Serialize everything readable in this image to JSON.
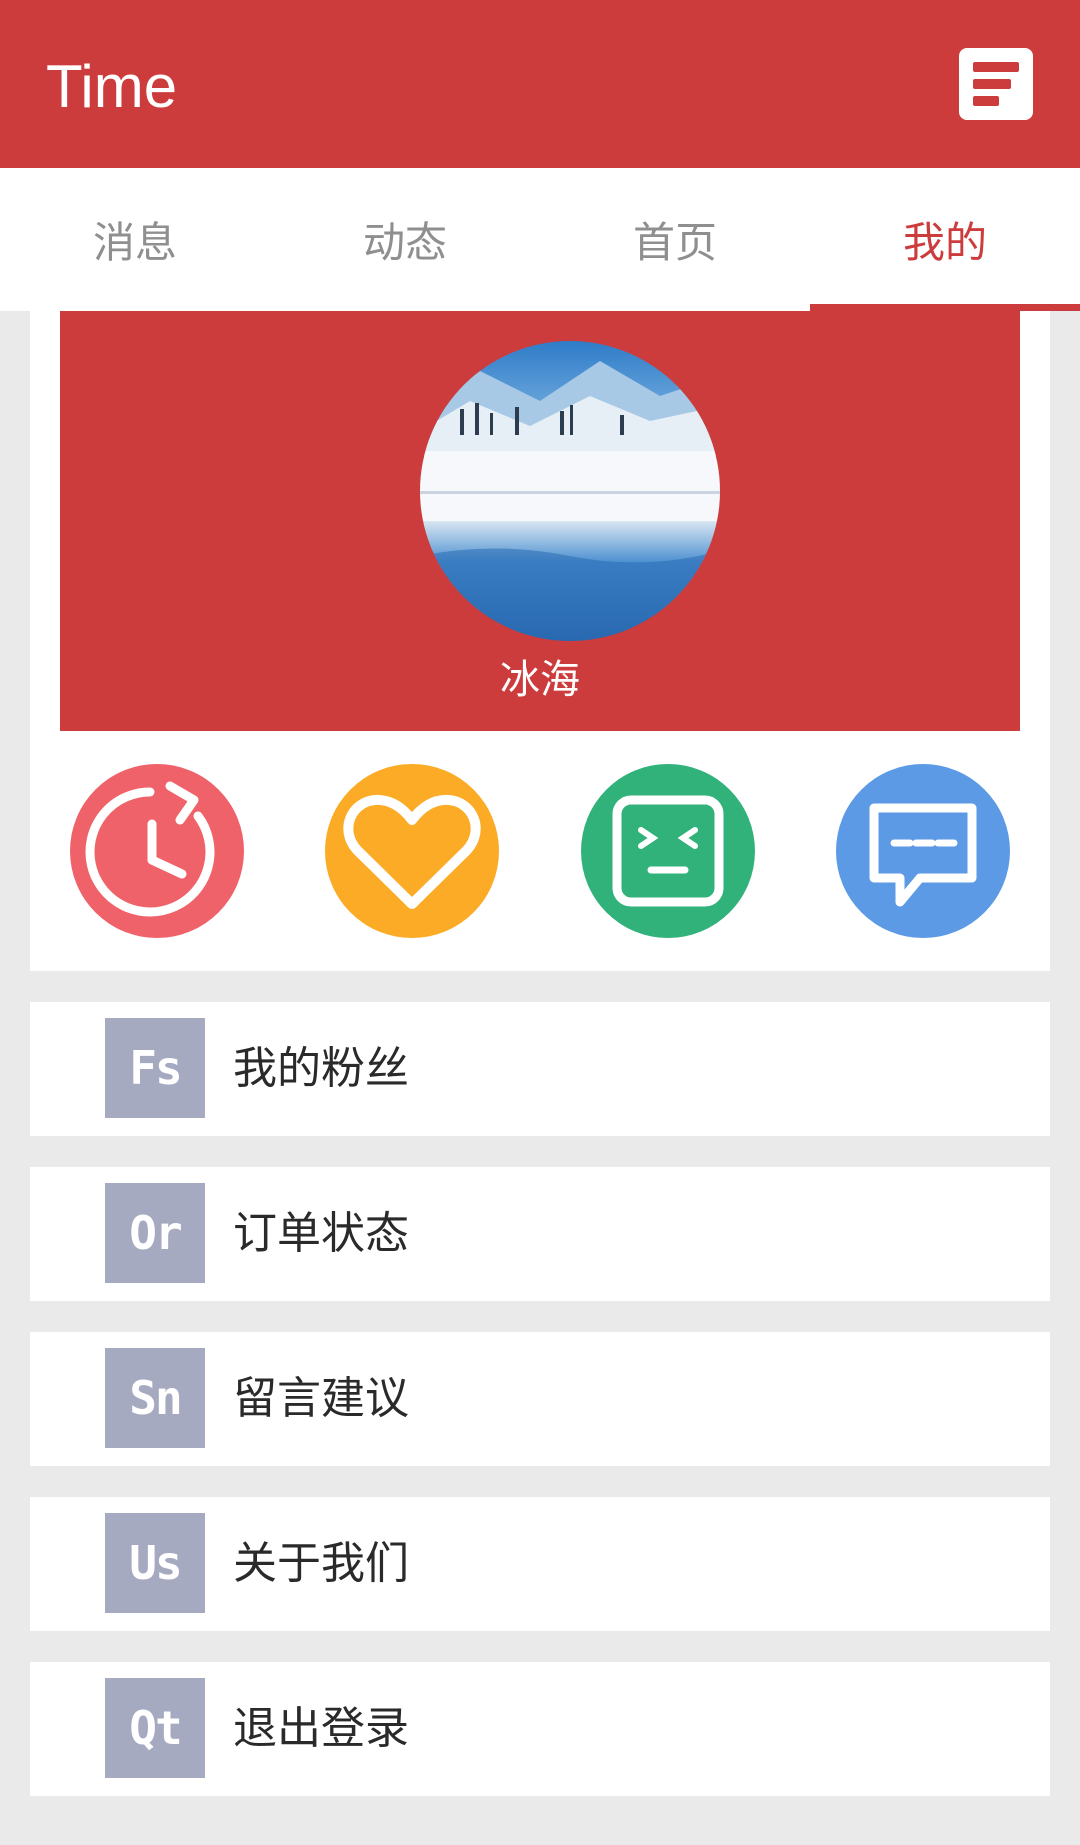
{
  "app": {
    "title": "Time"
  },
  "tabs": [
    {
      "label": "消息",
      "active": false
    },
    {
      "label": "动态",
      "active": false
    },
    {
      "label": "首页",
      "active": false
    },
    {
      "label": "我的",
      "active": true
    }
  ],
  "profile": {
    "name": "冰海"
  },
  "quick_actions": [
    {
      "icon": "history-clock-icon",
      "color": "#f0626a"
    },
    {
      "icon": "heart-icon",
      "color": "#fbab25"
    },
    {
      "icon": "face-box-icon",
      "color": "#31b27a"
    },
    {
      "icon": "chat-bubble-icon",
      "color": "#5c9ae6"
    }
  ],
  "menu": [
    {
      "badge": "Fs",
      "label": "我的粉丝"
    },
    {
      "badge": "Or",
      "label": "订单状态"
    },
    {
      "badge": "Sn",
      "label": "留言建议"
    },
    {
      "badge": "Us",
      "label": "关于我们"
    },
    {
      "badge": "Qt",
      "label": "退出登录"
    }
  ],
  "colors": {
    "primary": "#cd3c3c",
    "background": "#ebeaeb",
    "badge": "#a6aac1"
  }
}
